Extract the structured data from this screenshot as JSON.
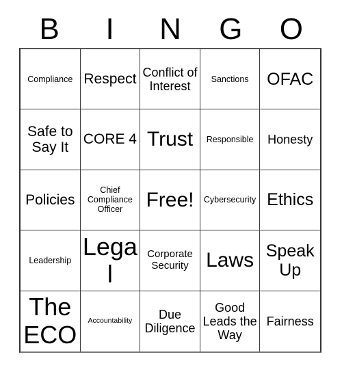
{
  "card": {
    "title": "BINGO",
    "headers": [
      "B",
      "I",
      "N",
      "G",
      "O"
    ],
    "rows": [
      [
        {
          "label": "Compliance",
          "size": "fs-sm"
        },
        {
          "label": "Respect",
          "size": "fs-xl"
        },
        {
          "label": "Conflict of Interest",
          "size": "fs-lg"
        },
        {
          "label": "Sanctions",
          "size": "fs-sm"
        },
        {
          "label": "OFAC",
          "size": "fs-xxl"
        }
      ],
      [
        {
          "label": "Safe to Say It",
          "size": "fs-xl"
        },
        {
          "label": "CORE 4",
          "size": "fs-xl"
        },
        {
          "label": "Trust",
          "size": "fs-huge"
        },
        {
          "label": "Responsible",
          "size": "fs-sm"
        },
        {
          "label": "Honesty",
          "size": "fs-lg"
        }
      ],
      [
        {
          "label": "Policies",
          "size": "fs-xl"
        },
        {
          "label": "Chief Compliance Officer",
          "size": "fs-sm"
        },
        {
          "label": "Free!",
          "size": "fs-huge"
        },
        {
          "label": "Cybersecurity",
          "size": "fs-sm"
        },
        {
          "label": "Ethics",
          "size": "fs-xxl"
        }
      ],
      [
        {
          "label": "Leadership",
          "size": "fs-sm"
        },
        {
          "label": "Legal",
          "size": "fs-mega"
        },
        {
          "label": "Corporate Security",
          "size": "fs-md"
        },
        {
          "label": "Laws",
          "size": "fs-huge"
        },
        {
          "label": "Speak Up",
          "size": "fs-xxl"
        }
      ],
      [
        {
          "label": "The ECO",
          "size": "fs-mega"
        },
        {
          "label": "Accountability",
          "size": "fs-xs"
        },
        {
          "label": "Due Diligence",
          "size": "fs-lg"
        },
        {
          "label": "Good Leads the Way",
          "size": "fs-lg"
        },
        {
          "label": "Fairness",
          "size": "fs-lg"
        }
      ]
    ],
    "free_space": {
      "row": 2,
      "col": 2,
      "label": "Free!"
    },
    "colors": {
      "background": "#ffffff",
      "text": "#000000",
      "border": "#3a3a3a"
    }
  }
}
